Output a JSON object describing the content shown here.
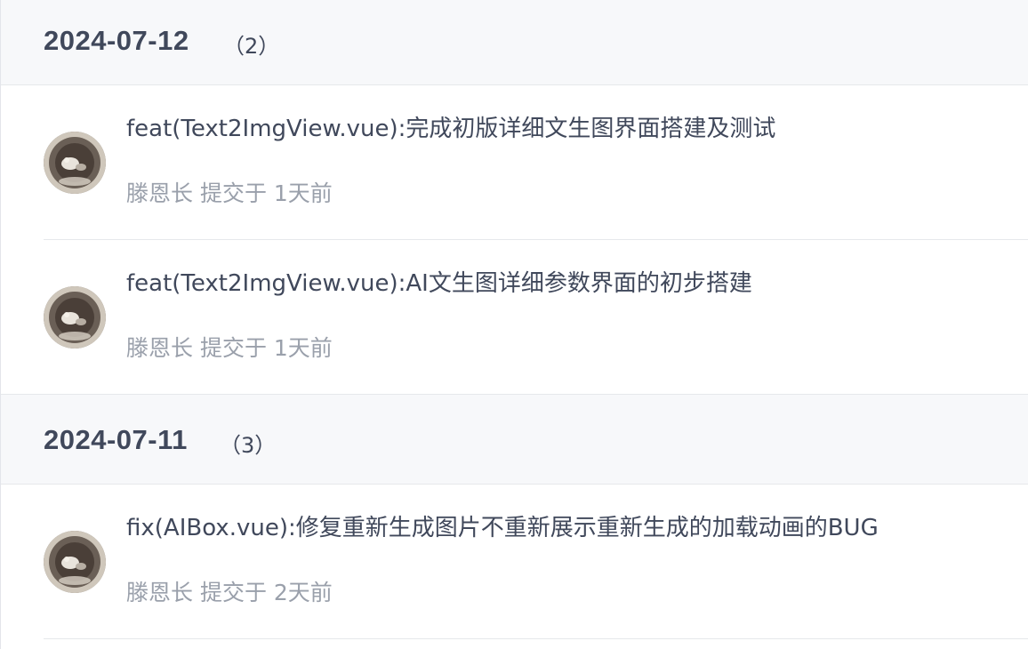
{
  "groups": [
    {
      "date": "2024-07-12",
      "count": "（2）",
      "commits": [
        {
          "message": "feat(Text2ImgView.vue):完成初版详细文生图界面搭建及测试",
          "meta": "滕恩长 提交于 1天前"
        },
        {
          "message": "feat(Text2ImgView.vue):AI文生图详细参数界面的初步搭建",
          "meta": "滕恩长 提交于 1天前"
        }
      ]
    },
    {
      "date": "2024-07-11",
      "count": "（3）",
      "commits": [
        {
          "message": "fix(AIBox.vue):修复重新生成图片不重新展示重新生成的加载动画的BUG",
          "meta": "滕恩长 提交于 2天前"
        }
      ]
    }
  ]
}
